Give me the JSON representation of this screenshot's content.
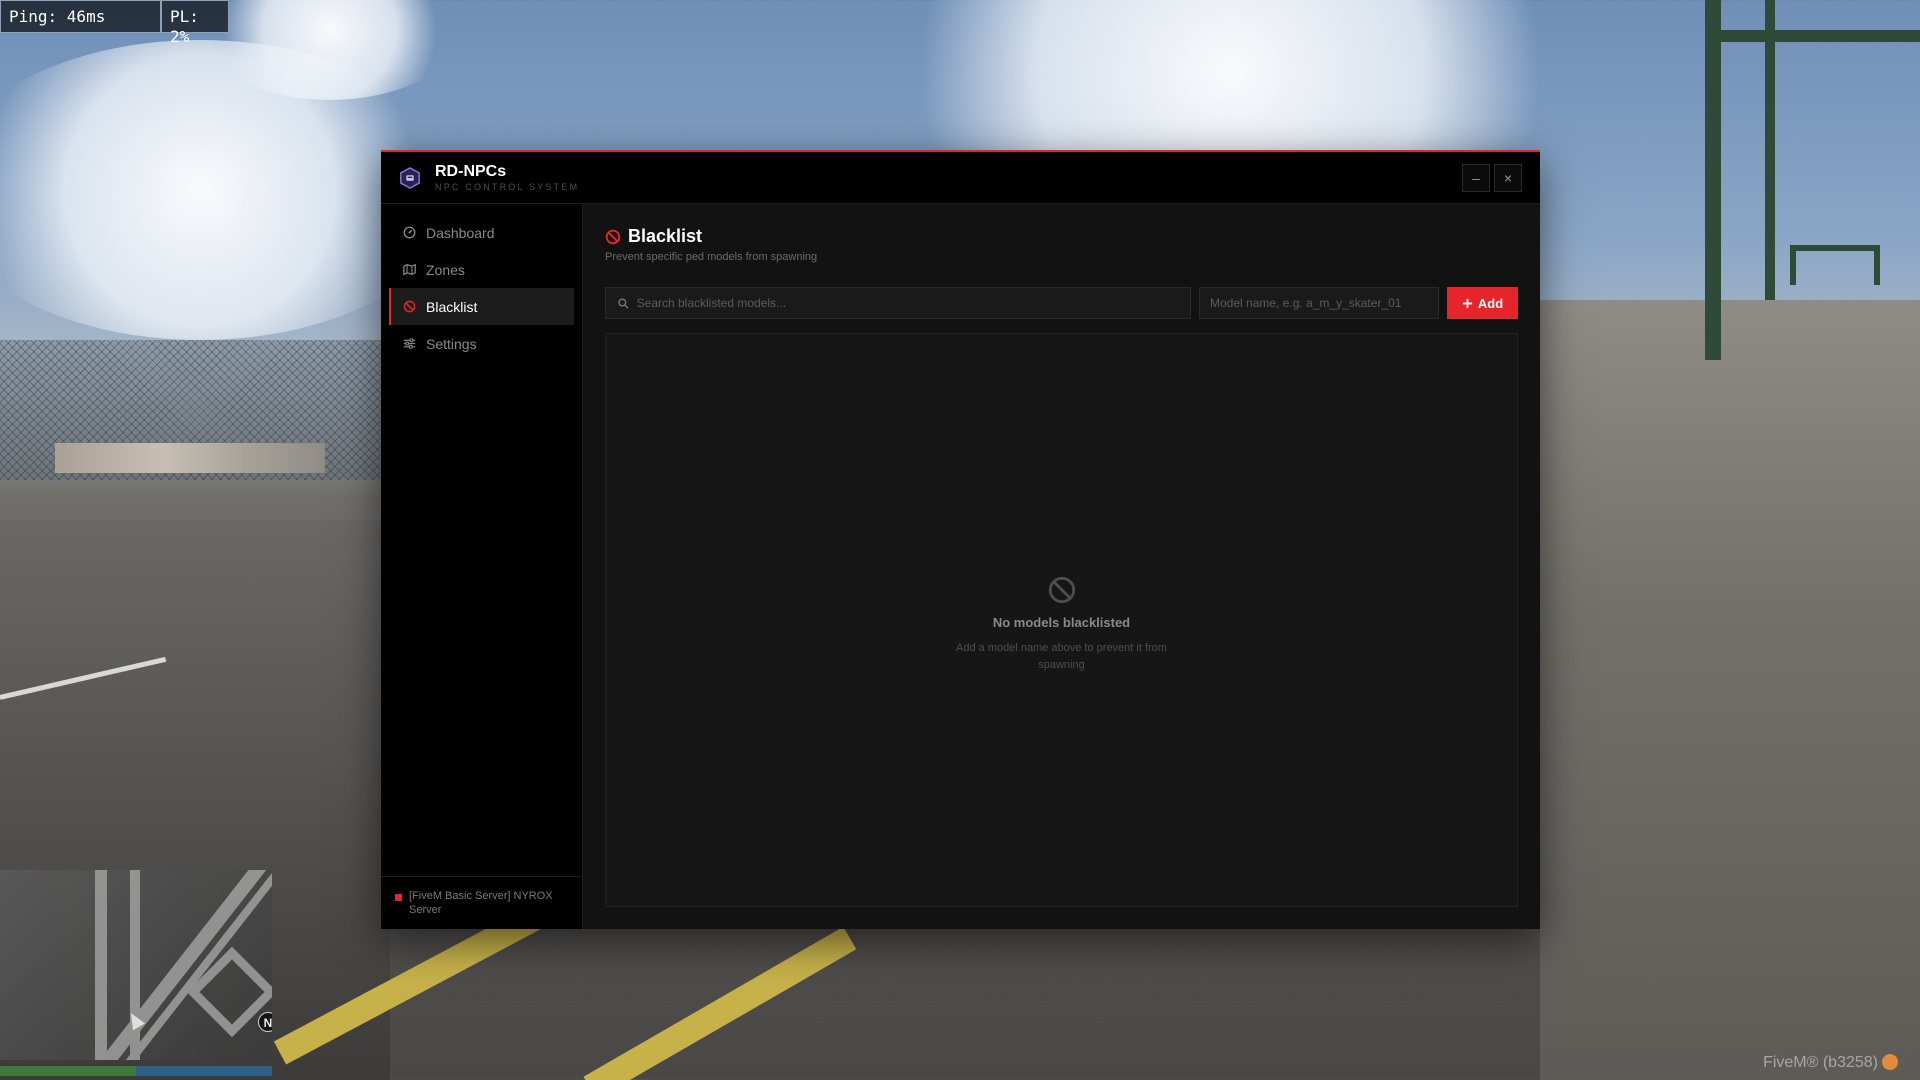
{
  "hud": {
    "ping": "Ping: 46ms",
    "packet_loss": "PL: 2%",
    "client_tag": "FiveM® (b3258)",
    "north": "N"
  },
  "app": {
    "title": "RD-NPCs",
    "subtitle": "NPC CONTROL SYSTEM",
    "minimize_label": "–",
    "close_label": "×",
    "accent_color": "#e5252a"
  },
  "sidebar": {
    "items": [
      {
        "label": "Dashboard",
        "icon": "gauge-icon",
        "active": false
      },
      {
        "label": "Zones",
        "icon": "map-icon",
        "active": false
      },
      {
        "label": "Blacklist",
        "icon": "ban-icon",
        "active": true
      },
      {
        "label": "Settings",
        "icon": "sliders-icon",
        "active": false
      }
    ],
    "server_name": "[FiveM Basic Server] NYROX Server"
  },
  "page": {
    "title": "Blacklist",
    "description": "Prevent specific ped models from spawning",
    "search_placeholder": "Search blacklisted models...",
    "model_placeholder": "Model name, e.g. a_m_y_skater_01",
    "add_label": "Add",
    "empty_title": "No models blacklisted",
    "empty_description": "Add a model name above to prevent it from spawning"
  }
}
